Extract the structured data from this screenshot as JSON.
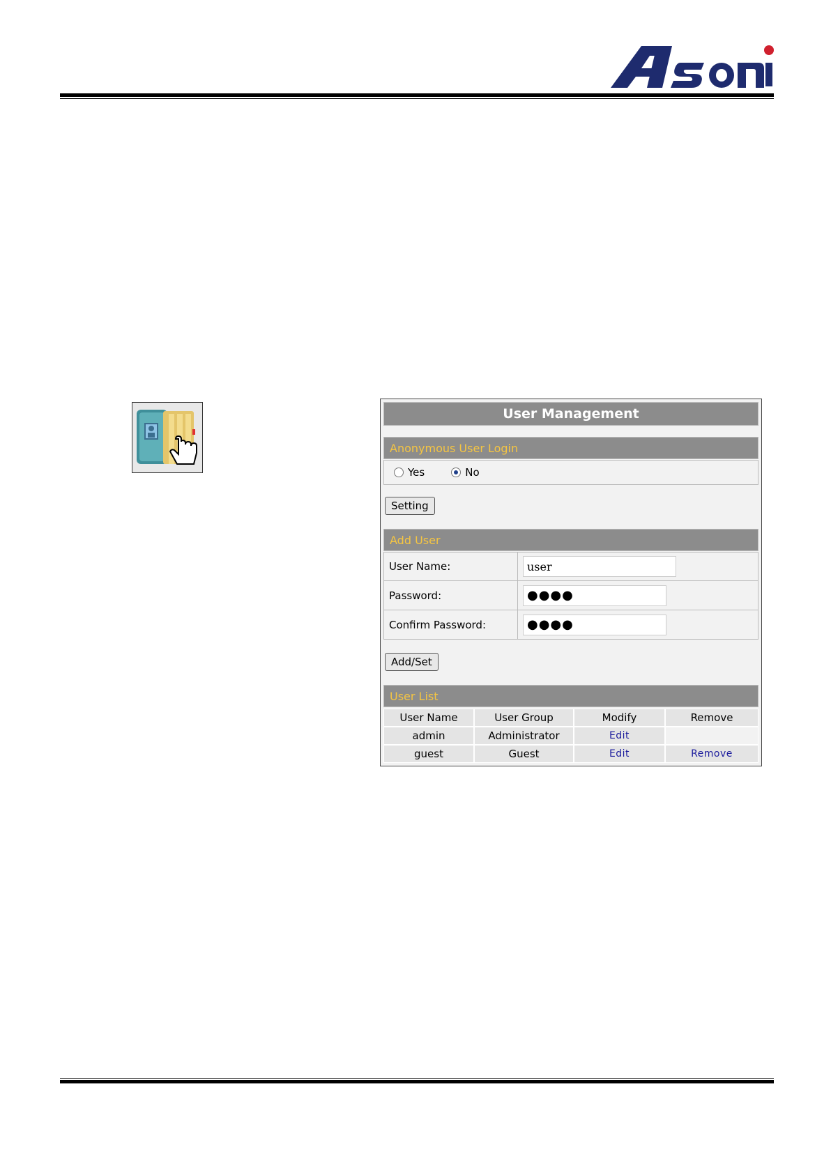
{
  "brand": {
    "logo_text": "Asoni",
    "accent_red": "#d0202e",
    "logo_navy": "#1e2b6e"
  },
  "panel": {
    "title": "User Management",
    "anonymous": {
      "header": "Anonymous User Login",
      "option_yes": "Yes",
      "option_no": "No",
      "selected": "No"
    },
    "setting_button": "Setting",
    "add_user": {
      "header": "Add User",
      "username_label": "User Name:",
      "username_value": "user",
      "password_label": "Password:",
      "password_value": "●●●●",
      "confirm_label": "Confirm Password:",
      "confirm_value": "●●●●"
    },
    "addset_button": "Add/Set",
    "user_list": {
      "header": "User List",
      "columns": [
        "User Name",
        "User Group",
        "Modify",
        "Remove"
      ],
      "rows": [
        {
          "name": "admin",
          "group": "Administrator",
          "modify": "Edit",
          "remove": ""
        },
        {
          "name": "guest",
          "group": "Guest",
          "modify": "Edit",
          "remove": "Remove"
        }
      ]
    }
  },
  "icons": {
    "app_icon": "user-folder-hand-icon"
  }
}
